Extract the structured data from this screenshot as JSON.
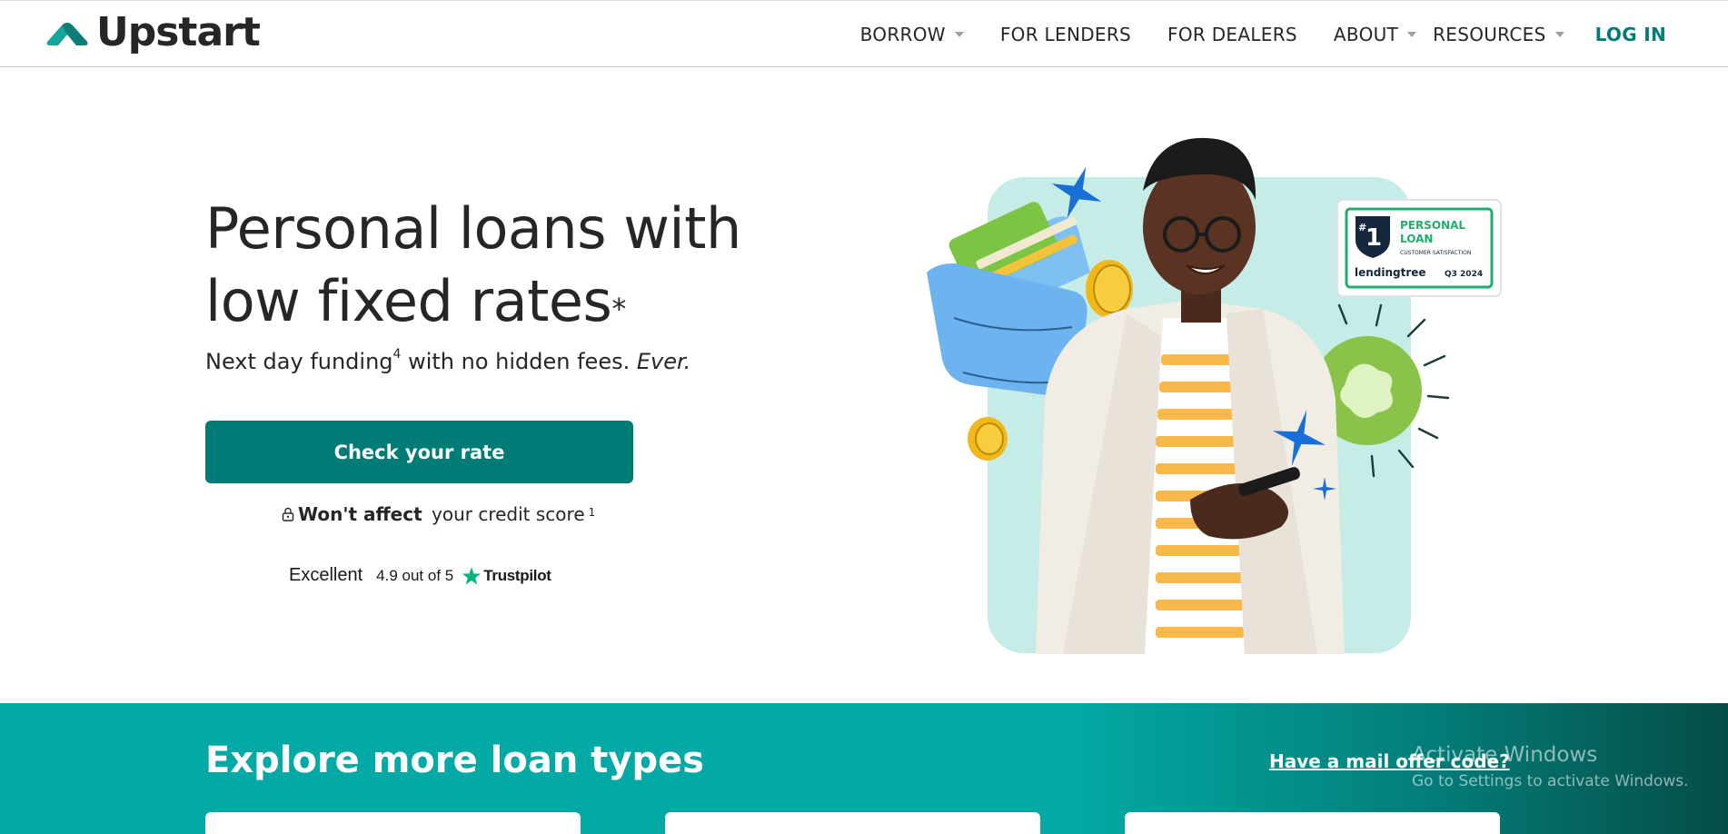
{
  "header": {
    "logo_text": "Upstart",
    "nav": [
      {
        "label": "BORROW",
        "dropdown": true
      },
      {
        "label": "FOR LENDERS",
        "dropdown": false
      },
      {
        "label": "FOR DEALERS",
        "dropdown": false
      },
      {
        "label": "ABOUT",
        "dropdown": true
      },
      {
        "label": "RESOURCES",
        "dropdown": true
      }
    ],
    "login_label": "LOG IN"
  },
  "hero": {
    "title_line1": "Personal loans with",
    "title_line2": "low fixed rates",
    "title_mark": "*",
    "subtitle_a": "Next day funding",
    "subtitle_sup": "4",
    "subtitle_b": " with no hidden fees. ",
    "subtitle_em": "Ever.",
    "cta_label": "Check your rate",
    "credit_bold": "Won't affect",
    "credit_rest": " your credit score",
    "credit_sup": "1",
    "trust_word": "Excellent",
    "trust_score": "4.9 out of 5",
    "trust_brand": "Trustpilot"
  },
  "badge": {
    "rank_hash": "#",
    "rank": "1",
    "line1": "PERSONAL",
    "line2": "LOAN",
    "line3": "CUSTOMER SATISFACTION",
    "brand": "lendingtree",
    "period": "Q3 2024"
  },
  "explore": {
    "title": "Explore more loan types",
    "mail_link": "Have a mail offer code?"
  },
  "watermark": {
    "line1": "Activate Windows",
    "line2": "Go to Settings to activate Windows."
  },
  "colors": {
    "brand_teal": "#007b76",
    "band_teal": "#03a9a4",
    "trustpilot_green": "#00b67a",
    "text": "#262626"
  }
}
